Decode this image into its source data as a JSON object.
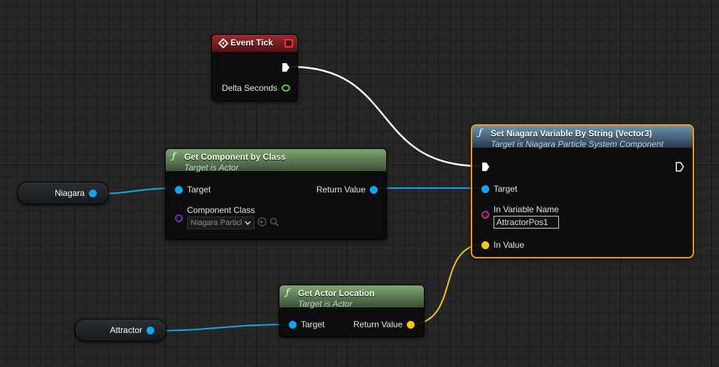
{
  "event_tick": {
    "title": "Event Tick",
    "pins": {
      "delta_seconds": "Delta Seconds"
    },
    "colors": {
      "header": "#9c2a2f",
      "float_pin": "#59d047"
    }
  },
  "get_component_by_class": {
    "title": "Get Component by Class",
    "subtitle": "Target is Actor",
    "pins": {
      "target": "Target",
      "component_class": "Component Class",
      "return_value": "Return Value"
    },
    "class_dropdown_value": "Niagara Particl",
    "colors": {
      "header": "#5d7e55"
    }
  },
  "set_niagara_var": {
    "title": "Set Niagara Variable By String (Vector3)",
    "subtitle": "Target is Niagara Particle System Component",
    "pins": {
      "target": "Target",
      "in_variable_name": "In Variable Name",
      "in_value": "In Value"
    },
    "variable_name_value": "AttractorPos1",
    "colors": {
      "header": "#4c6e8c",
      "selection_outline": "#f29a18"
    }
  },
  "get_actor_location": {
    "title": "Get Actor Location",
    "subtitle": "Target is Actor",
    "pins": {
      "target": "Target",
      "return_value": "Return Value"
    },
    "colors": {
      "header": "#5d7e55"
    }
  },
  "variables": {
    "niagara": "Niagara",
    "attractor": "Attractor"
  },
  "pin_colors": {
    "object": "#10a6ee",
    "vector": "#f5c518",
    "class": "#8e24b8",
    "string": "#d81ba6",
    "exec": "#ffffff"
  },
  "icons": {
    "event": "event-diamond-icon",
    "function": "function-f-icon",
    "delegate": "delegate-square-icon",
    "use_selected": "arrow-left-circle-icon",
    "browse": "magnifier-icon",
    "dropdown": "chevron-down-icon"
  }
}
